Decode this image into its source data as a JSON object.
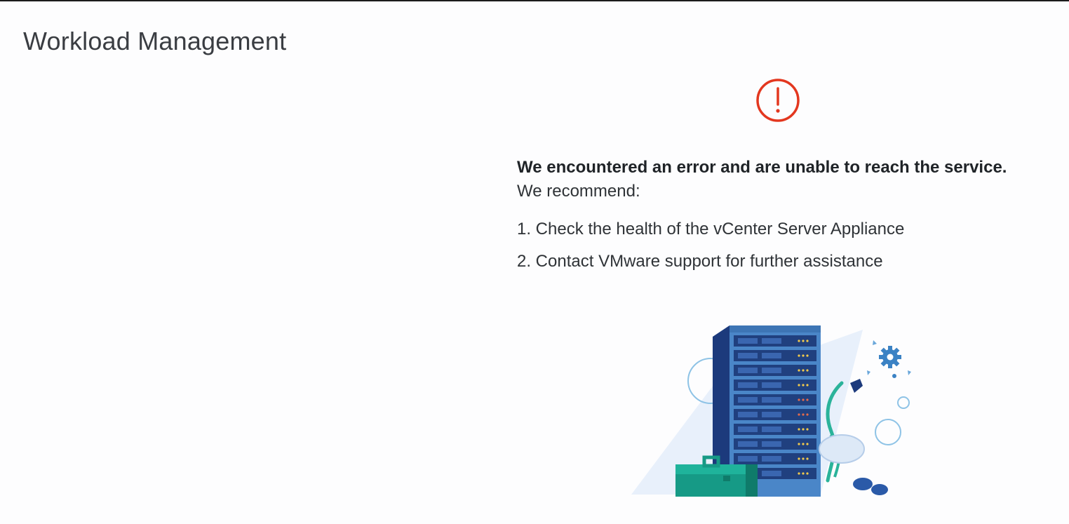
{
  "page": {
    "title": "Workload Management"
  },
  "error": {
    "icon": "exclamation-circle-icon",
    "icon_color": "#e3371f",
    "heading": "We encountered an error and are unable to reach the service.",
    "recommend_label": "We recommend:",
    "steps": [
      "1. Check the health of the vCenter Server Appliance",
      "2. Contact VMware support for further assistance"
    ]
  },
  "illustration": {
    "name": "server-rack-illustration",
    "colors": {
      "rack_dark": "#1f3a7a",
      "rack_light": "#4a86c8",
      "toolbox": "#1aa28c",
      "gear": "#3b82c4",
      "cable": "#2bb39a"
    }
  }
}
